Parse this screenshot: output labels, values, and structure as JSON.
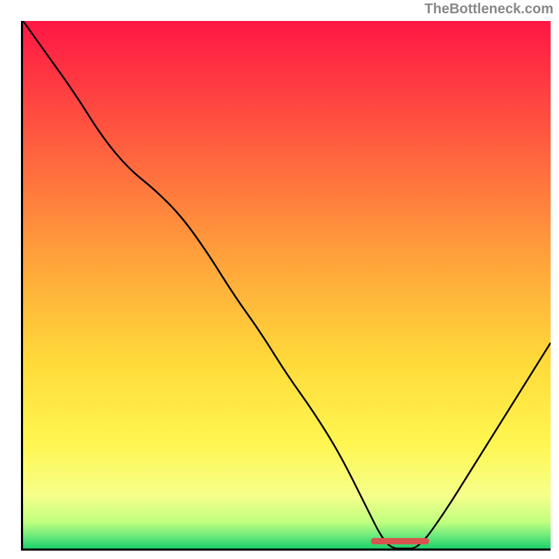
{
  "watermark": "TheBottleneck.com",
  "chart_data": {
    "type": "line",
    "title": "",
    "xlabel": "",
    "ylabel": "",
    "xlim": [
      0,
      100
    ],
    "ylim": [
      0,
      100
    ],
    "x": [
      0,
      5,
      10,
      15,
      20,
      25,
      30,
      35,
      40,
      45,
      50,
      55,
      60,
      65,
      68,
      70,
      72,
      75,
      80,
      85,
      90,
      95,
      100
    ],
    "values": [
      100,
      93,
      86,
      78,
      72,
      68,
      63,
      56,
      48,
      41,
      33,
      26,
      18,
      8,
      2,
      0,
      0,
      0,
      7,
      15,
      23,
      31,
      39
    ],
    "gradient_stops": [
      {
        "pos": 0.0,
        "color": "#ff1744"
      },
      {
        "pos": 0.2,
        "color": "#ff5340"
      },
      {
        "pos": 0.45,
        "color": "#ffa23b"
      },
      {
        "pos": 0.65,
        "color": "#ffdb3a"
      },
      {
        "pos": 0.8,
        "color": "#fff650"
      },
      {
        "pos": 0.9,
        "color": "#f6ff8a"
      },
      {
        "pos": 0.95,
        "color": "#c0ff80"
      },
      {
        "pos": 0.98,
        "color": "#5fe67a"
      },
      {
        "pos": 1.0,
        "color": "#1ecf6a"
      }
    ],
    "optimal_range_x": [
      66,
      77
    ],
    "marker_color": "#d9534f"
  }
}
